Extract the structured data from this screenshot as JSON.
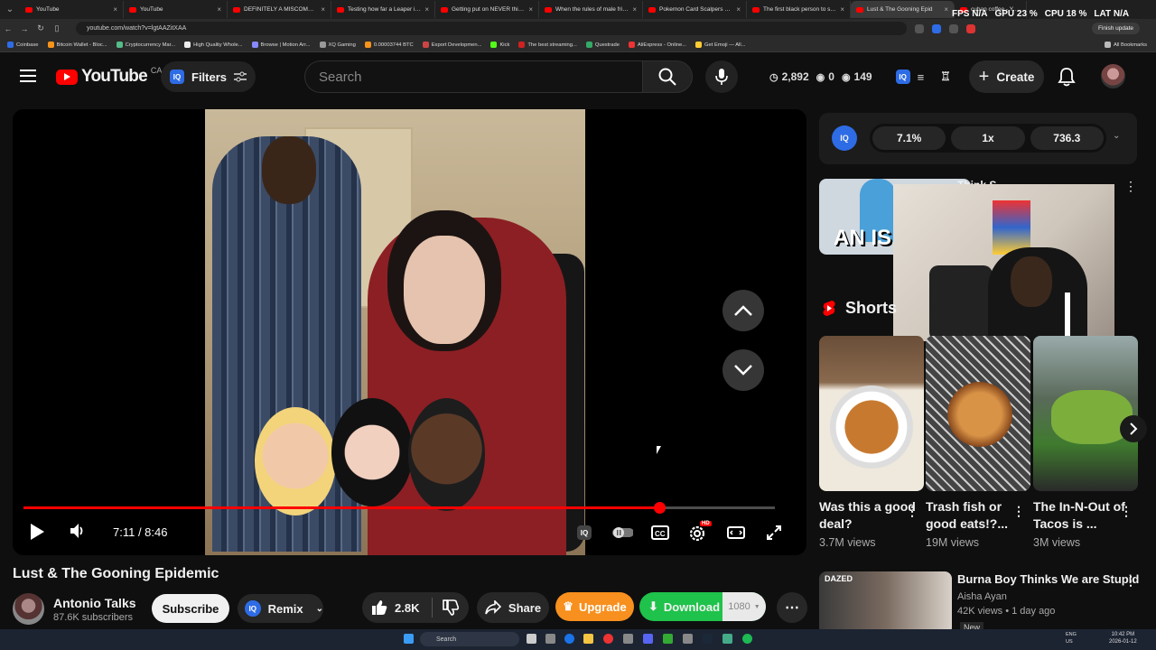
{
  "browser": {
    "tabs": [
      {
        "title": "YouTube"
      },
      {
        "title": "YouTube"
      },
      {
        "title": "DEFINITELY A MISCOMMUNI"
      },
      {
        "title": "Testing how far a Leaper in a"
      },
      {
        "title": "Getting put on NEVER this se"
      },
      {
        "title": "When the rules of male friend"
      },
      {
        "title": "Pokemon Card Scalpers But T"
      },
      {
        "title": "The first black person to say t"
      },
      {
        "title": "Lust & The Gooning Epid"
      },
      {
        "title": "cuban coffee - YouTube"
      }
    ],
    "overlay_stats": {
      "fps_label": "FPS",
      "fps": "N/A",
      "gpu_label": "GPU",
      "gpu": "23 %",
      "cpu_label": "CPU",
      "cpu": "18 %",
      "lat_label": "LAT",
      "lat": "N/A"
    },
    "url": "youtube.com/watch?v=lgtAAZitXAA",
    "finish_update": "Finish update",
    "bookmarks": [
      "Coinbase",
      "Bitcoin Wallet - Bloc...",
      "Cryptocurrency Mar...",
      "High Quality Whole...",
      "Browse | Motion Arr...",
      "XQ Gaming",
      "0.00003744 BTC",
      "Export Developmen...",
      "Kick",
      "The best streaming...",
      "Questrade",
      "AliExpress - Online...",
      "Get Emoji — All..."
    ],
    "all_bookmarks": "All Bookmarks"
  },
  "header": {
    "logo_text": "YouTube",
    "country": "CA",
    "filters_label": "Filters",
    "iq_badge": "IQ",
    "search_placeholder": "Search",
    "stats": {
      "views": "2,892",
      "watching": "0",
      "eyes": "149"
    },
    "create_label": "Create"
  },
  "player": {
    "time": "7:11 / 8:46",
    "progress_fraction": 0.846,
    "hd_badge": "HD"
  },
  "video": {
    "title": "Lust & The Gooning Epidemic",
    "channel": "Antonio Talks",
    "subscribers": "87.6K subscribers",
    "subscribe_label": "Subscribe",
    "remix_label": "Remix",
    "likes": "2.8K",
    "share_label": "Share",
    "upgrade_label": "Upgrade",
    "download_label": "Download",
    "quality": "1080"
  },
  "sidebar": {
    "iq_logo": "IQ",
    "iq_pills": [
      "7.1%",
      "1x",
      "736.3"
    ],
    "rec1_thumb_text": "AN IS",
    "rec1_title": "Think S...",
    "shorts_label": "Shorts",
    "shorts": [
      {
        "title": "Was this a good deal?",
        "views": "3.7M views"
      },
      {
        "title": "Trash fish or good eats!?...",
        "views": "19M views"
      },
      {
        "title": "The In-N-Out of Tacos is ...",
        "views": "3M views"
      }
    ],
    "rec2": {
      "title": "Burna Boy Thinks We are Stupid",
      "channel": "Aisha Ayan",
      "meta": "42K views • 1 day ago",
      "badge": "New",
      "thumb_text": "DAZED"
    }
  },
  "taskbar": {
    "search_placeholder": "Search",
    "lang": "ENG",
    "region": "US",
    "time": "10:42 PM",
    "date": "2026-01-12"
  }
}
